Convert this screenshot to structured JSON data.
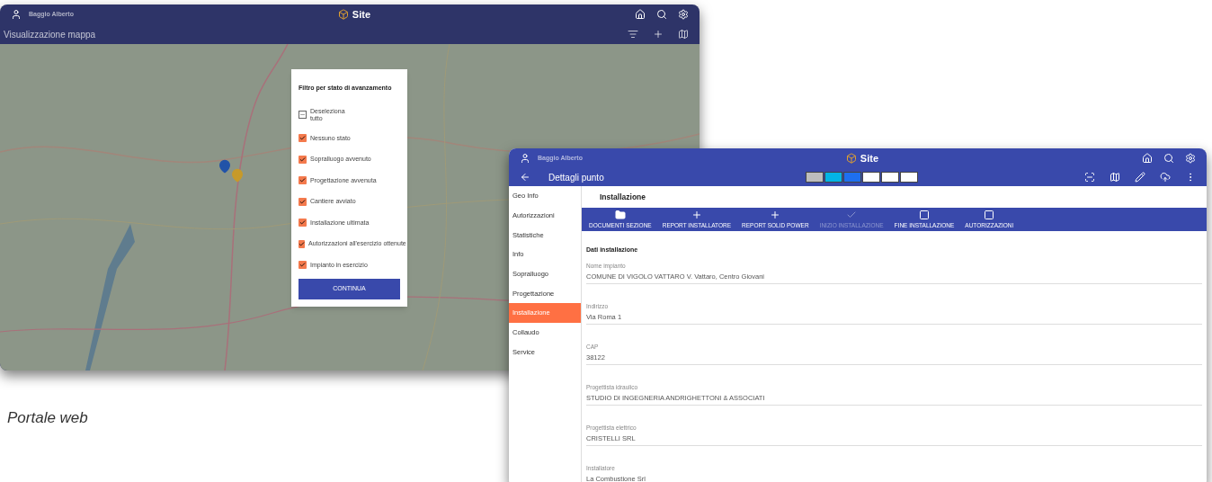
{
  "web_window": {
    "user": "Baggio Alberto",
    "logo": "Site",
    "title": "Visualizzazione mappa",
    "filter_dialog": {
      "title": "Filtro per stato di avanzamento",
      "deselect_all": {
        "label": "Deseleziona tutto",
        "indeterminate": true
      },
      "options": [
        {
          "label": "Nessuno stato",
          "checked": true
        },
        {
          "label": "Sopralluogo avvenuto",
          "checked": true
        },
        {
          "label": "Progettazione avvenuta",
          "checked": true
        },
        {
          "label": "Cantiere avviato",
          "checked": true
        },
        {
          "label": "Installazione ultimata",
          "checked": true
        },
        {
          "label": "Autorizzazioni all'esercizio ottenute",
          "checked": true
        },
        {
          "label": "Impianto in esercizio",
          "checked": true
        }
      ],
      "button": "CONTINUA"
    }
  },
  "caption": "Portale web",
  "detail_window": {
    "user": "Baggio Alberto",
    "logo": "Site",
    "title": "Dettagli punto",
    "steps": [
      {
        "color": "#bdbdbd"
      },
      {
        "color": "#03b4e6"
      },
      {
        "color": "#1e6ff0"
      },
      {
        "color": "#ffffff"
      },
      {
        "color": "#ffffff"
      },
      {
        "color": "#ffffff"
      }
    ],
    "sidebar": [
      {
        "label": "Geo Info",
        "selected": false
      },
      {
        "label": "Autorizzazioni",
        "selected": false
      },
      {
        "label": "Statistiche",
        "selected": false
      },
      {
        "label": "Info",
        "selected": false
      },
      {
        "label": "Sopralluogo",
        "selected": false
      },
      {
        "label": "Progettazione",
        "selected": false
      },
      {
        "label": "Installazione",
        "selected": true
      },
      {
        "label": "Collaudo",
        "selected": false
      },
      {
        "label": "Service",
        "selected": false
      }
    ],
    "section_title": "Installazione",
    "actions": [
      {
        "kind": "folder",
        "label": "DOCUMENTI SEZIONE",
        "disabled": false
      },
      {
        "kind": "add",
        "label": "REPORT INSTALLATORE",
        "disabled": false
      },
      {
        "kind": "add",
        "label": "REPORT SOLID POWER",
        "disabled": false
      },
      {
        "kind": "check",
        "label": "INIZIO INSTALLAZIONE",
        "disabled": true
      },
      {
        "kind": "box",
        "label": "FINE INSTALLAZIONE",
        "disabled": false
      },
      {
        "kind": "box",
        "label": "AUTORIZZAZIONI",
        "disabled": false
      }
    ],
    "card_title": "Dati installazione",
    "fields": [
      {
        "label": "Nome impianto",
        "value": "COMUNE DI VIGOLO VATTARO V. Vattaro, Centro Giovani"
      },
      {
        "label": "Indirizzo",
        "value": "Via Roma 1"
      },
      {
        "label": "CAP",
        "value": "38122"
      },
      {
        "label": "Progettista idraulico",
        "value": "STUDIO DI INGEGNERIA ANDRIGHETTONI & ASSOCIATI"
      },
      {
        "label": "Progettista elettrico",
        "value": "CRISTELLI SRL"
      },
      {
        "label": "Installatore",
        "value": "La Combustione Srl"
      }
    ]
  }
}
